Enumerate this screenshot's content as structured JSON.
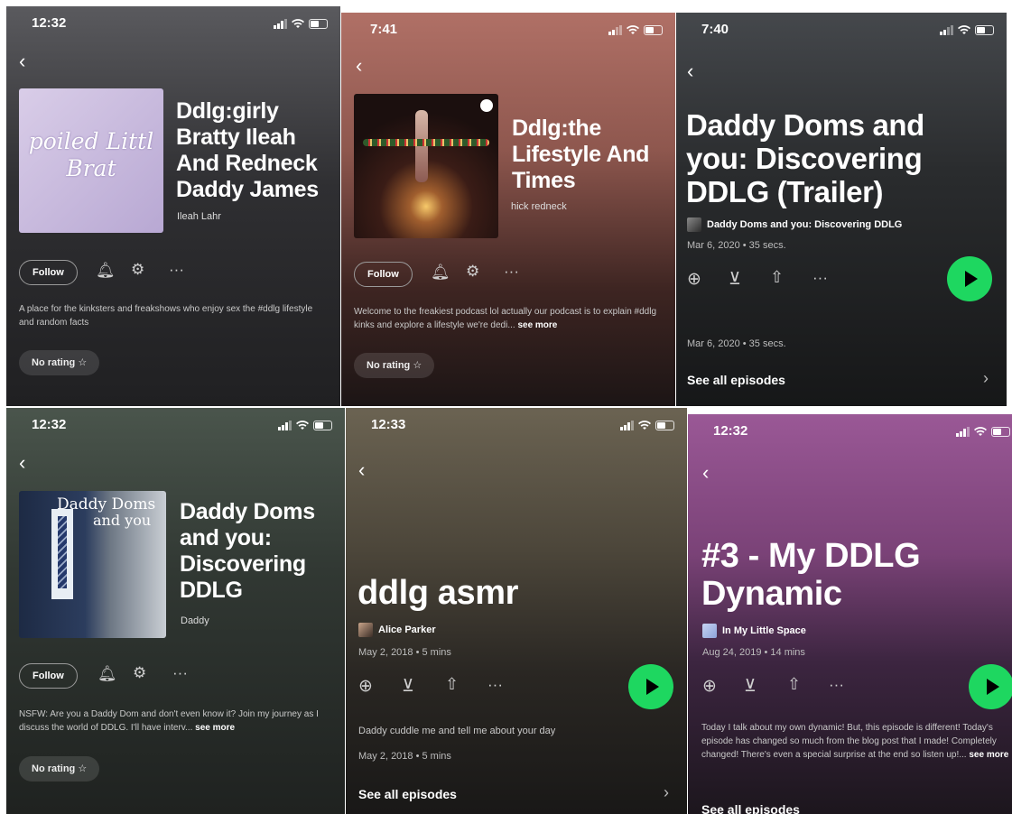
{
  "panels": [
    {
      "time": "12:32",
      "title": "Ddlg:girly Bratty Ileah And Redneck Daddy James",
      "author": "Ileah Lahr",
      "cover_text": "poiled Littl Brat",
      "follow": "Follow",
      "description": "A place for the kinksters and freakshows who enjoy sex the #ddlg lifestyle and random facts",
      "rating": "No rating",
      "bg": "#2b2b2e"
    },
    {
      "time": "7:41",
      "title": "Ddlg:the Lifestyle And Times",
      "author": "hick redneck",
      "follow": "Follow",
      "description": "Welcome to the freakiest podcast lol actually our podcast is to explain #ddlg kinks and explore a lifestyle we're dedi...",
      "see_more": "see more",
      "rating": "No rating",
      "bg": "#a4665c"
    },
    {
      "time": "7:40",
      "title": "Daddy Doms and you: Discovering DDLG (Trailer)",
      "show": "Daddy Doms and you: Discovering DDLG",
      "meta": "Mar 6, 2020 • 35 secs.",
      "meta2": "Mar 6, 2020 • 35 secs.",
      "see_all": "See all episodes",
      "bg": "#3b3d40"
    },
    {
      "time": "12:32",
      "title": "Daddy Doms and you: Discovering DDLG",
      "author": "Daddy",
      "cover_text_1": "Daddy Doms",
      "cover_text_2": "and you",
      "follow": "Follow",
      "description": "NSFW: Are you a Daddy Dom and don't even know it? Join my journey as I discuss the world of DDLG. I'll have interv...",
      "see_more": "see more",
      "rating": "No rating",
      "bg": "#374039"
    },
    {
      "time": "12:33",
      "title": "ddlg asmr",
      "show": "Alice Parker",
      "meta": "May 2, 2018 • 5 mins",
      "description": "Daddy cuddle me and tell me about your day",
      "meta2": "May 2, 2018 • 5 mins",
      "see_all": "See all episodes",
      "bg": "#575043"
    },
    {
      "time": "12:32",
      "title": "#3 - My DDLG Dynamic",
      "show": "In My Little Space",
      "meta": "Aug 24, 2019 • 14 mins",
      "description": "Today I talk about my own dynamic! But, this episode is different! Today's episode has changed so much from the blog post that I made! Completely changed! There's even a special surprise at the end so listen up!...",
      "see_more": "see more",
      "see_all": "See all episodes",
      "bg": "#8a4a86"
    }
  ],
  "icons": {
    "back": "chevron-left-icon",
    "bell": "bell-icon",
    "settings": "gear-icon",
    "more": "more-dots-icon",
    "add": "plus-circle-icon",
    "download": "download-icon",
    "share": "share-icon",
    "star": "star-icon",
    "play": "play-icon"
  },
  "colors": {
    "play_green": "#1ed760"
  }
}
